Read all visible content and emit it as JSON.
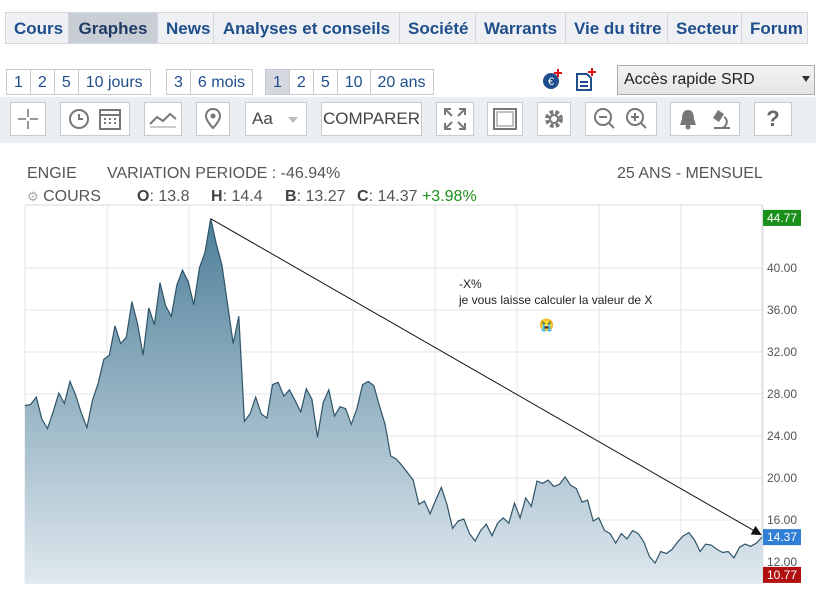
{
  "nav": {
    "tabs": [
      {
        "label": "Cours",
        "width": 63
      },
      {
        "label": "Graphes",
        "width": 89,
        "active": true
      },
      {
        "label": "News",
        "width": 56
      },
      {
        "label": "Analyses et conseils",
        "width": 186
      },
      {
        "label": "Société",
        "width": 76
      },
      {
        "label": "Warrants",
        "width": 90
      },
      {
        "label": "Vie du titre",
        "width": 102
      },
      {
        "label": "Secteur",
        "width": 74
      },
      {
        "label": "Forum",
        "width": 67
      }
    ]
  },
  "periods_days": [
    "1",
    "2",
    "5",
    "10 jours"
  ],
  "periods_months": [
    "3",
    "6 mois"
  ],
  "periods_years": [
    "1",
    "2",
    "5",
    "10",
    "20 ans"
  ],
  "quick_access": "Accès rapide SRD",
  "toolbar": {
    "compare_label": "COMPARER",
    "font_label": "Aa"
  },
  "header": {
    "ticker": "ENGIE",
    "variation": "VARIATION PERIODE : -46.94%",
    "mode": "25 ANS - MENSUEL",
    "cours_label": "COURS",
    "open_label": "O",
    "open_value": "13.8",
    "high_label": "H",
    "high_value": "14.4",
    "low_label": "B",
    "low_value": "13.27",
    "close_label": "C",
    "close_value": "14.37",
    "change": "+3.98%"
  },
  "annotation": {
    "line1": "-X%",
    "line2": "je vous laisse calculer la valeur de X"
  },
  "colors": {
    "area_top": "#4e7f99",
    "area_bottom": "#dfe8ee",
    "max_badge": "#1b8f1b",
    "last_badge": "#2f7fd6",
    "min_badge": "#b01010"
  },
  "chart_data": {
    "type": "area",
    "ylim": [
      10.0,
      46.0
    ],
    "yticks": [
      "12.00",
      "16.00",
      "20.00",
      "24.00",
      "28.00",
      "32.00",
      "36.00",
      "40.00"
    ],
    "max_label": "44.77",
    "last_label": "14.37",
    "min_label": "10.77",
    "values": [
      26.9,
      27.0,
      27.7,
      25.6,
      24.7,
      26.3,
      28.1,
      27.1,
      29.2,
      27.9,
      26.2,
      24.8,
      27.4,
      29.0,
      31.3,
      31.7,
      34.5,
      32.8,
      33.4,
      36.8,
      34.7,
      31.7,
      36.2,
      34.6,
      38.6,
      36.4,
      35.4,
      38.4,
      39.8,
      38.7,
      36.5,
      40.0,
      41.5,
      44.7,
      42.3,
      40.3,
      36.6,
      32.8,
      35.4,
      25.4,
      26.1,
      27.7,
      26.1,
      25.7,
      28.9,
      29.1,
      27.8,
      28.4,
      27.4,
      26.3,
      28.5,
      27.5,
      23.9,
      27.2,
      28.4,
      25.9,
      26.8,
      26.6,
      25.1,
      26.6,
      28.9,
      29.2,
      28.8,
      26.9,
      25.1,
      22.1,
      21.8,
      21.2,
      20.5,
      19.8,
      17.5,
      17.8,
      16.6,
      17.9,
      19.1,
      17.5,
      15.2,
      15.9,
      16.1,
      14.7,
      14.0,
      15.0,
      15.6,
      14.5,
      15.7,
      16.2,
      15.7,
      17.6,
      16.2,
      18.1,
      17.3,
      19.7,
      19.5,
      19.8,
      19.2,
      19.4,
      20.1,
      19.3,
      19.0,
      17.7,
      17.9,
      15.9,
      16.2,
      15.0,
      14.7,
      13.8,
      14.7,
      14.2,
      15.0,
      14.7,
      13.9,
      12.5,
      11.9,
      13.0,
      12.8,
      13.2,
      13.9,
      14.5,
      14.8,
      14.1,
      13.0,
      13.7,
      13.6,
      13.2,
      12.9,
      13.0,
      12.4,
      13.4,
      13.7,
      13.5,
      13.8,
      14.37
    ]
  }
}
